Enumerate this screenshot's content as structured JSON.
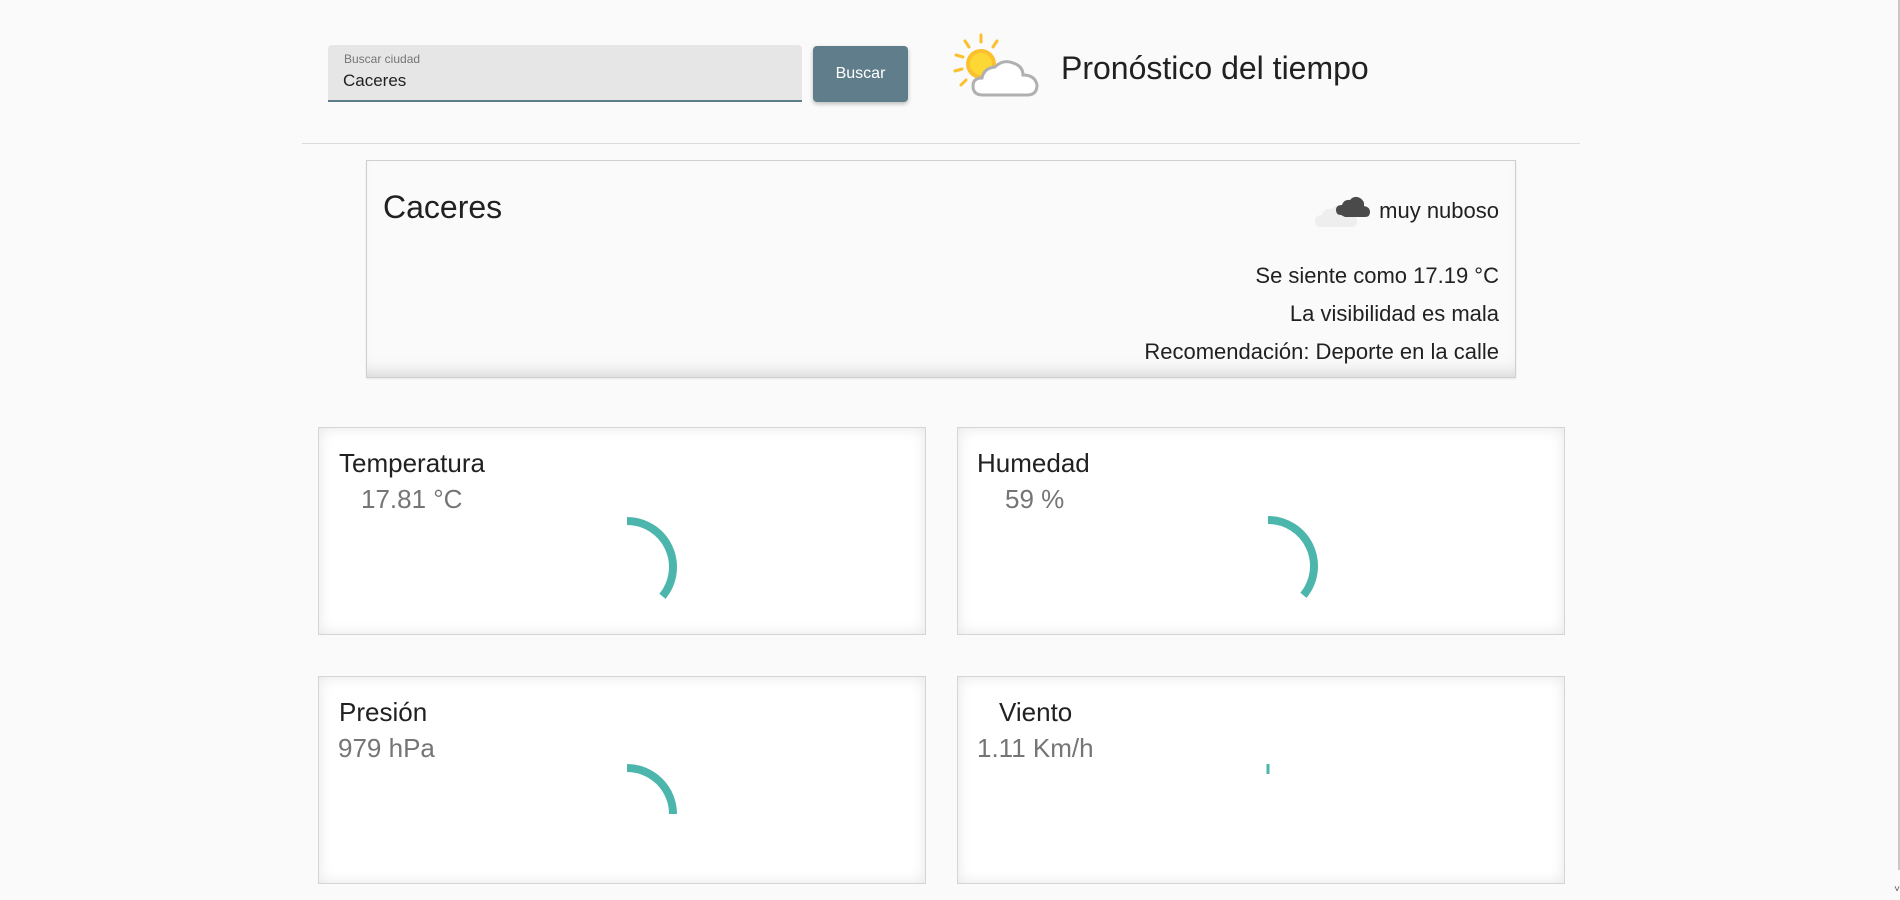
{
  "search": {
    "label": "Buscar ciudad",
    "value": "Caceres",
    "button_label": "Buscar"
  },
  "header": {
    "title": "Pronóstico del tiempo",
    "logo_icon": "sun-behind-cloud-icon"
  },
  "summary": {
    "city": "Caceres",
    "condition": "muy nuboso",
    "condition_icon": "cloudy-icon",
    "feels_like": "Se siente como 17.19 °C",
    "visibility": "La visibilidad es mala",
    "recommendation": "Recomendación: Deporte en la calle"
  },
  "metrics": {
    "temperature": {
      "title": "Temperatura",
      "value": "17.81 °C",
      "gauge_fraction": 0.36
    },
    "humidity": {
      "title": "Humedad",
      "value": "59 %",
      "gauge_fraction": 0.36
    },
    "pressure": {
      "title": "Presión",
      "value": "979 hPa",
      "gauge_fraction": 0.25
    },
    "wind": {
      "title": "Viento",
      "value": "1.11 Km/h",
      "gauge_fraction": 0.01
    }
  },
  "colors": {
    "accent": "#607d8b",
    "gauge": "#4db6ac",
    "sun": "#fbc02d",
    "cloud_dark": "#4a4a4a"
  }
}
